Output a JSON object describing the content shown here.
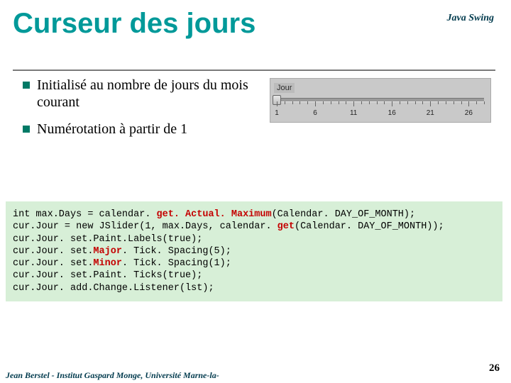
{
  "header": {
    "course": "Java Swing"
  },
  "title": "Curseur des jours",
  "bullets": [
    "Initialisé au nombre de jours du mois courant",
    "Numérotation à partir de 1"
  ],
  "slider": {
    "label": "Jour",
    "min": 1,
    "max": 28,
    "major": 5,
    "value": 1,
    "major_ticks": [
      1,
      6,
      11,
      16,
      21,
      26
    ]
  },
  "code": {
    "l1a": "int max.Days = calendar. ",
    "l1m": "get. Actual. Maximum",
    "l1b": "(Calendar. DAY_OF_MONTH);",
    "l2a": "cur.Jour = new JSlider(1, max.Days, calendar. ",
    "l2m": "get",
    "l2b": "(Calendar. DAY_OF_MONTH));",
    "l3": "cur.Jour. set.Paint.Labels(true);",
    "l4a": "cur.Jour. set.",
    "l4m": "Major",
    "l4b": ". Tick. Spacing(5);",
    "l5a": "cur.Jour. set.",
    "l5m": "Minor",
    "l5b": ". Tick. Spacing(1);",
    "l6": "cur.Jour. set.Paint. Ticks(true);",
    "l7": "cur.Jour. add.Change.Listener(lst);"
  },
  "footer": "Jean Berstel  -   Institut Gaspard Monge, Université Marne-la-",
  "page": "26"
}
